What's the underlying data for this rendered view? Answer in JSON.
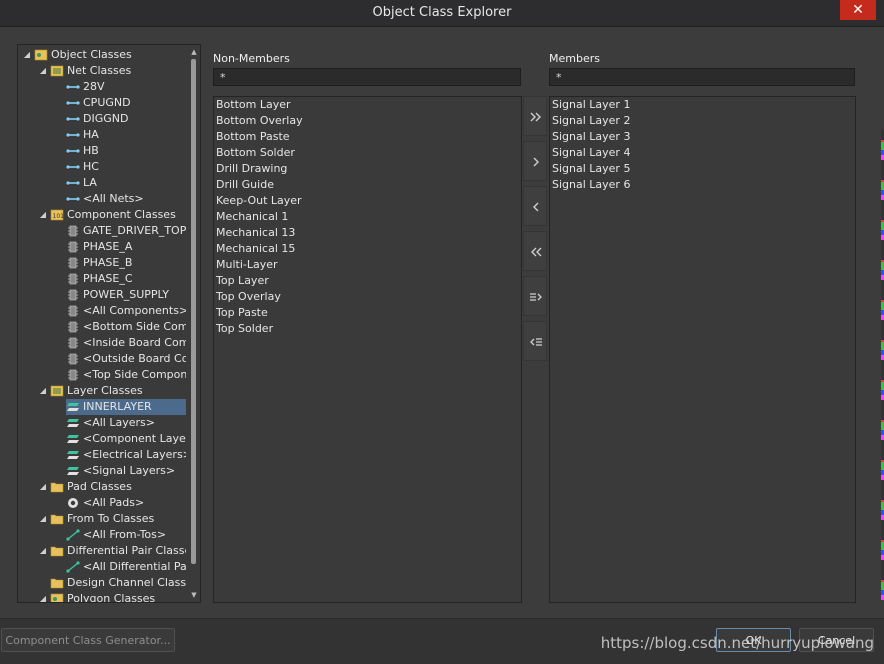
{
  "window": {
    "title": "Object Class Explorer",
    "close_label": "✕"
  },
  "tree": {
    "root_label": "Object Classes",
    "net_classes": {
      "label": "Net Classes",
      "items": [
        "28V",
        "CPUGND",
        "DIGGND",
        "HA",
        "HB",
        "HC",
        "LA",
        "<All Nets>"
      ]
    },
    "component_classes": {
      "label": "Component Classes",
      "items": [
        "GATE_DRIVER_TOP",
        "PHASE_A",
        "PHASE_B",
        "PHASE_C",
        "POWER_SUPPLY",
        "<All Components>",
        "<Bottom Side Comp",
        "<Inside Board Com",
        "<Outside Board Co",
        "<Top Side Compon"
      ]
    },
    "layer_classes": {
      "label": "Layer Classes",
      "items": [
        "INNERLAYER",
        "<All Layers>",
        "<Component Layer",
        "<Electrical Layers>",
        "<Signal Layers>"
      ],
      "selected": "INNERLAYER"
    },
    "pad_classes": {
      "label": "Pad Classes",
      "items": [
        "<All Pads>"
      ]
    },
    "from_to_classes": {
      "label": "From To Classes",
      "items": [
        "<All From-Tos>"
      ]
    },
    "diff_pair_classes": {
      "label": "Differential Pair Classe",
      "items": [
        "<All Differential Pai"
      ]
    },
    "design_channel_classes": {
      "label": "Design Channel Classe"
    },
    "polygon_classes": {
      "label": "Polygon Classes"
    }
  },
  "non_members": {
    "heading": "Non-Members",
    "filter_value": "*",
    "items": [
      "Bottom Layer",
      "Bottom Overlay",
      "Bottom Paste",
      "Bottom Solder",
      "Drill Drawing",
      "Drill Guide",
      "Keep-Out Layer",
      "Mechanical 1",
      "Mechanical 13",
      "Mechanical 15",
      "Multi-Layer",
      "Top Layer",
      "Top Overlay",
      "Top Paste",
      "Top Solder"
    ]
  },
  "members": {
    "heading": "Members",
    "filter_value": "*",
    "items": [
      "Signal Layer 1",
      "Signal Layer 2",
      "Signal Layer 3",
      "Signal Layer 4",
      "Signal Layer 5",
      "Signal Layer 6"
    ]
  },
  "footer": {
    "generator_label": "Component Class Generator...",
    "ok_label": "OK",
    "cancel_label": "Cancel"
  },
  "watermark": "https://blog.csdn.net/hurryupiowang",
  "colors": {
    "accent_selection": "#4c6a8c",
    "close_button": "#c42b1c",
    "background": "#3c3c3c"
  }
}
